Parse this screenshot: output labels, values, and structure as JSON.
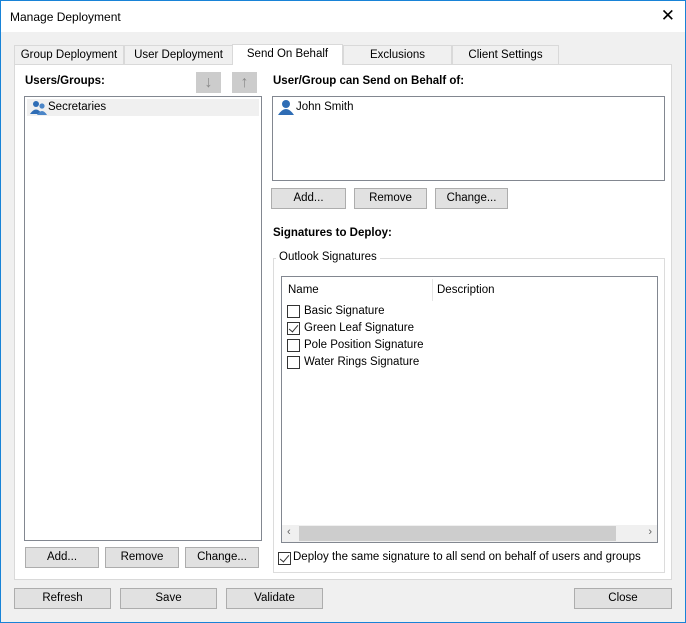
{
  "window": {
    "title": "Manage Deployment",
    "close_icon": "close-icon"
  },
  "tabs": [
    {
      "label": "Group Deployment"
    },
    {
      "label": "User Deployment"
    },
    {
      "label": "Send On Behalf",
      "active": true
    },
    {
      "label": "Exclusions"
    },
    {
      "label": "Client Settings"
    }
  ],
  "left": {
    "heading": "Users/Groups:",
    "items": [
      {
        "label": "Secretaries",
        "icon": "group-icon",
        "selected": true
      }
    ],
    "add": "Add...",
    "remove": "Remove",
    "change": "Change...",
    "move_down_icon": "arrow-down-icon",
    "move_up_icon": "arrow-up-icon"
  },
  "right": {
    "heading": "User/Group can Send on Behalf of:",
    "items": [
      {
        "label": "John Smith",
        "icon": "user-icon"
      }
    ],
    "add": "Add...",
    "remove": "Remove",
    "change": "Change..."
  },
  "signatures": {
    "heading": "Signatures to Deploy:",
    "group_label": "Outlook Signatures",
    "columns": [
      "Name",
      "Description"
    ],
    "items": [
      {
        "name": "Basic Signature",
        "checked": false
      },
      {
        "name": "Green Leaf Signature",
        "checked": true
      },
      {
        "name": "Pole Position Signature",
        "checked": false
      },
      {
        "name": "Water Rings Signature",
        "checked": false
      }
    ],
    "same_signature_label": "Deploy the same signature to all send on behalf of users and groups",
    "same_signature_checked": true
  },
  "footer": {
    "refresh": "Refresh",
    "save": "Save",
    "validate": "Validate",
    "close": "Close"
  },
  "colors": {
    "accent": "#1883d7",
    "icon_blue": "#2f6db5",
    "selection": "#f0f0f0"
  }
}
